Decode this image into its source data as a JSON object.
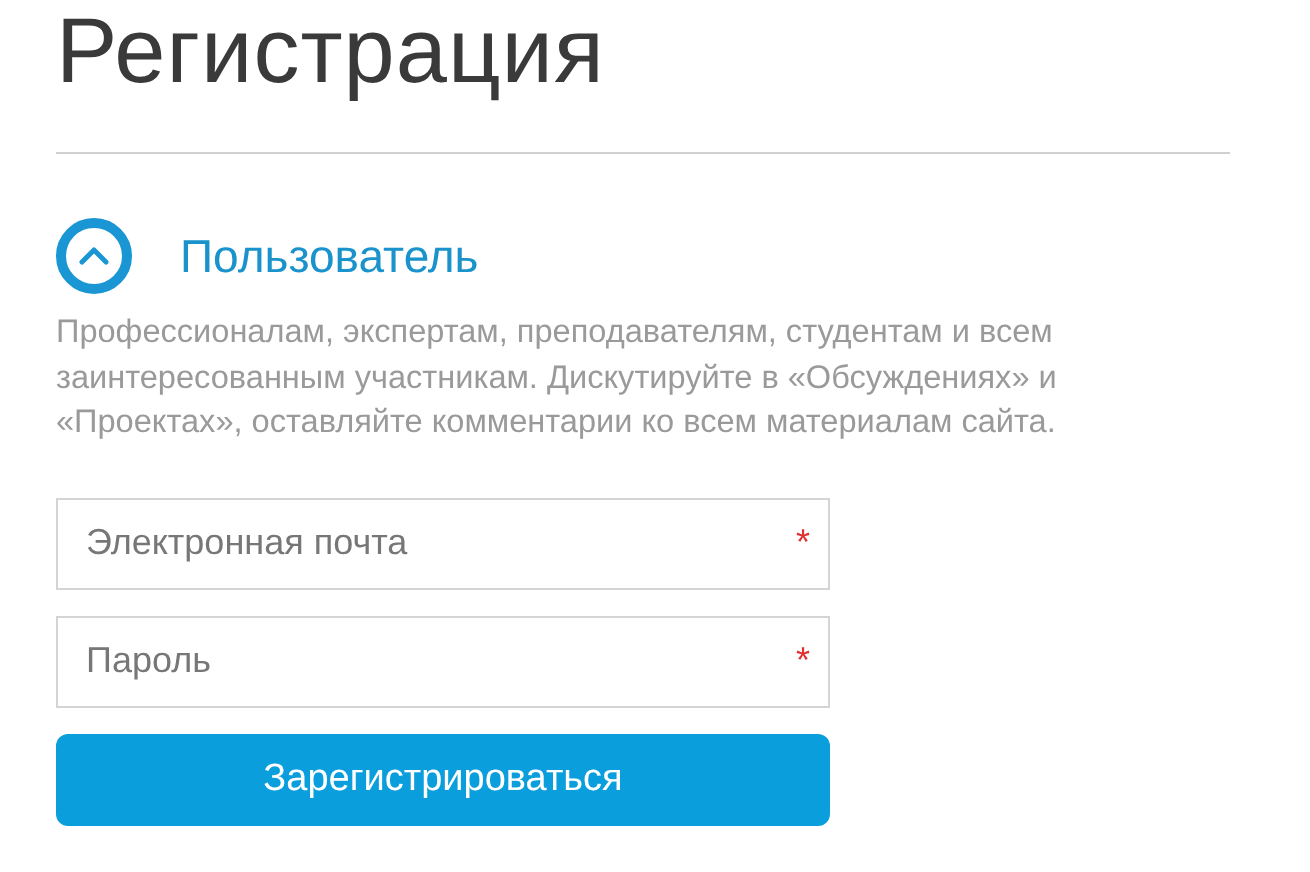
{
  "title": "Регистрация",
  "section": {
    "heading": "Пользователь",
    "expanded": true,
    "description": "Профессионалам, экспертам, преподавателям, студентам и всем заинтересованным участникам. Дискутируйте в «Обсуждениях» и «Проектах», оставляйте комментарии ко всем материалам сайта."
  },
  "fields": [
    {
      "placeholder": "Электронная почта",
      "required_mark": "*"
    },
    {
      "placeholder": "Пароль",
      "required_mark": "*"
    }
  ],
  "submit": {
    "label": "Зарегистрироваться"
  }
}
